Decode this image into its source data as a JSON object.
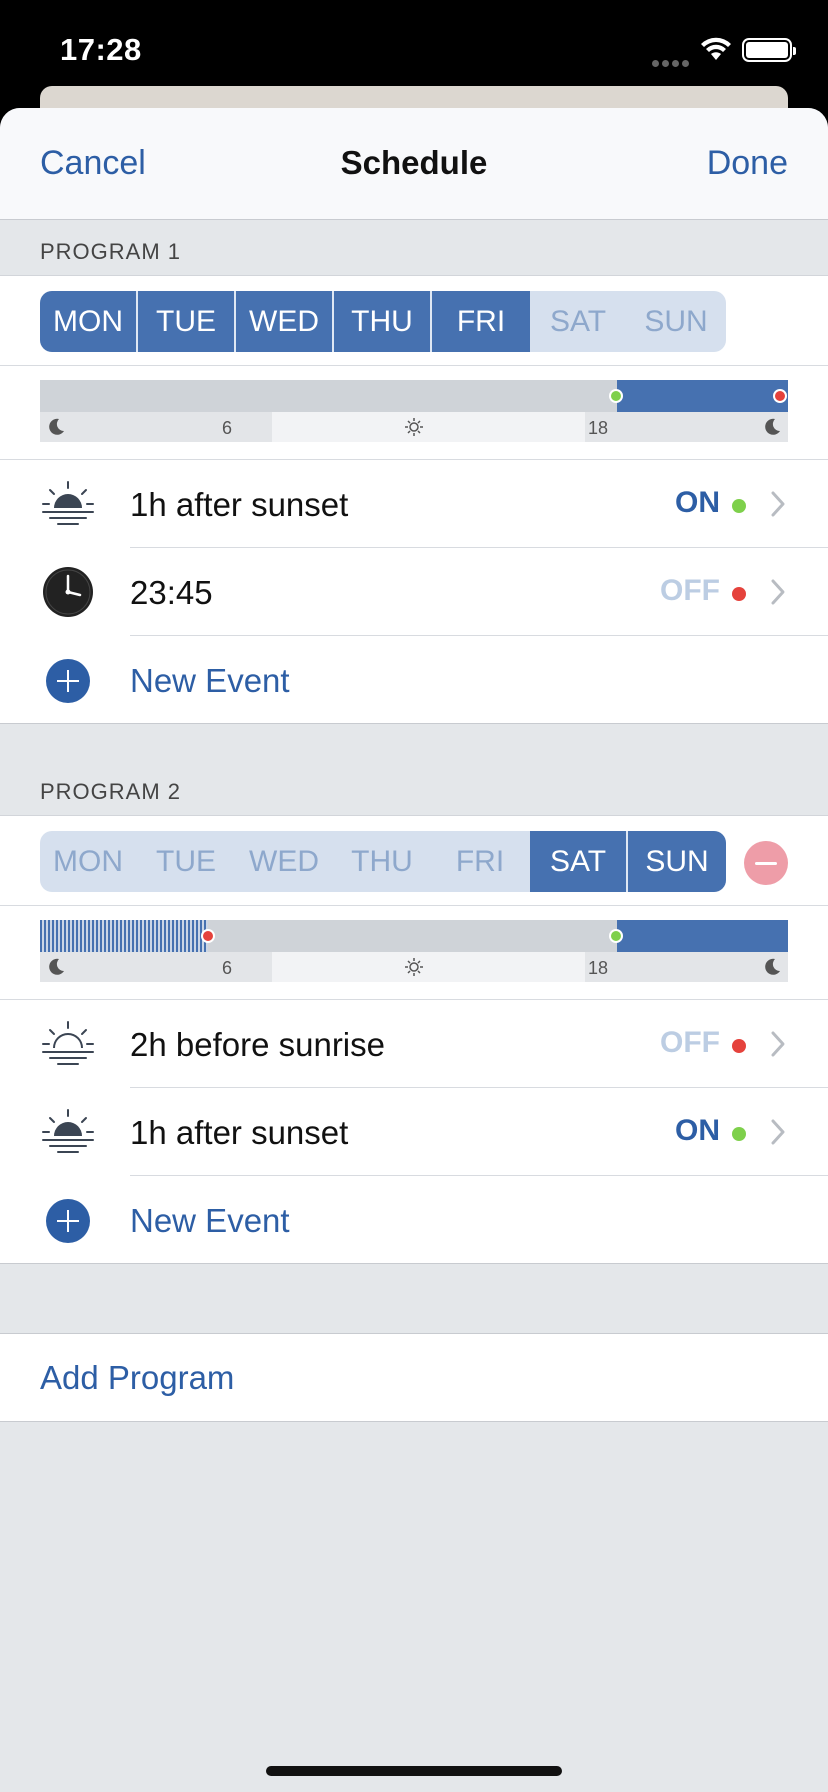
{
  "status_bar": {
    "time": "17:28"
  },
  "nav": {
    "cancel": "Cancel",
    "title": "Schedule",
    "done": "Done"
  },
  "programs": [
    {
      "header": "PROGRAM 1",
      "days": [
        {
          "label": "MON",
          "active": true
        },
        {
          "label": "TUE",
          "active": true
        },
        {
          "label": "WED",
          "active": true
        },
        {
          "label": "THU",
          "active": true
        },
        {
          "label": "FRI",
          "active": true
        },
        {
          "label": "SAT",
          "active": false
        },
        {
          "label": "SUN",
          "active": false
        }
      ],
      "timeline": {
        "tick_6": "6",
        "tick_18": "18"
      },
      "events": [
        {
          "label": "1h after sunset",
          "state": "ON",
          "icon": "sunset-icon"
        },
        {
          "label": "23:45",
          "state": "OFF",
          "icon": "clock-icon"
        }
      ],
      "new_event": "New Event"
    },
    {
      "header": "PROGRAM 2",
      "days": [
        {
          "label": "MON",
          "active": false
        },
        {
          "label": "TUE",
          "active": false
        },
        {
          "label": "WED",
          "active": false
        },
        {
          "label": "THU",
          "active": false
        },
        {
          "label": "FRI",
          "active": false
        },
        {
          "label": "SAT",
          "active": true
        },
        {
          "label": "SUN",
          "active": true
        }
      ],
      "timeline": {
        "tick_6": "6",
        "tick_18": "18"
      },
      "events": [
        {
          "label": "2h before sunrise",
          "state": "OFF",
          "icon": "sunrise-icon"
        },
        {
          "label": "1h after sunset",
          "state": "ON",
          "icon": "sunset-icon"
        }
      ],
      "new_event": "New Event"
    }
  ],
  "add_program": "Add Program",
  "colors": {
    "accent": "#2d5ea5",
    "active_day": "#4671b0",
    "on_dot": "#7ed04b",
    "off_dot": "#e5423c"
  }
}
